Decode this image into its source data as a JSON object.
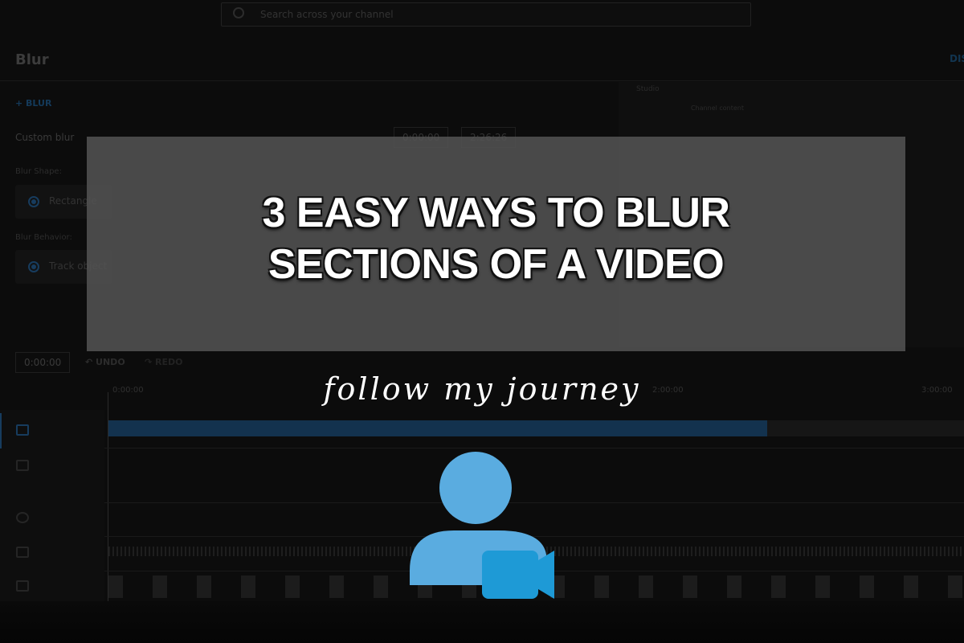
{
  "search": {
    "placeholder": "Search across your channel",
    "icon": "search-icon"
  },
  "editor": {
    "title": "Blur",
    "discard_label": "DIS",
    "add_blur_label": "BLUR",
    "custom_blur": {
      "label": "Custom blur",
      "start": "0:00:00",
      "end": "2:26:26"
    },
    "blur_shape": {
      "label": "Blur Shape:",
      "value": "Rectangle"
    },
    "blur_behavior": {
      "label": "Blur Behavior:",
      "value": "Track object"
    }
  },
  "preview": {
    "app_name": "Studio",
    "heading": "Channel content"
  },
  "timeline": {
    "current_time": "0:00:00",
    "undo_label": "UNDO",
    "redo_label": "REDO",
    "ruler": [
      "0:00:00",
      "2:00:00",
      "3:00:00"
    ]
  },
  "overlay": {
    "headline_line1": "3 EASY WAYS TO BLUR",
    "headline_line2": "SECTIONS OF A VIDEO",
    "tagline": "follow my journey",
    "logo_colors": {
      "person": "#5aace0",
      "camera": "#1e9ad6"
    }
  }
}
